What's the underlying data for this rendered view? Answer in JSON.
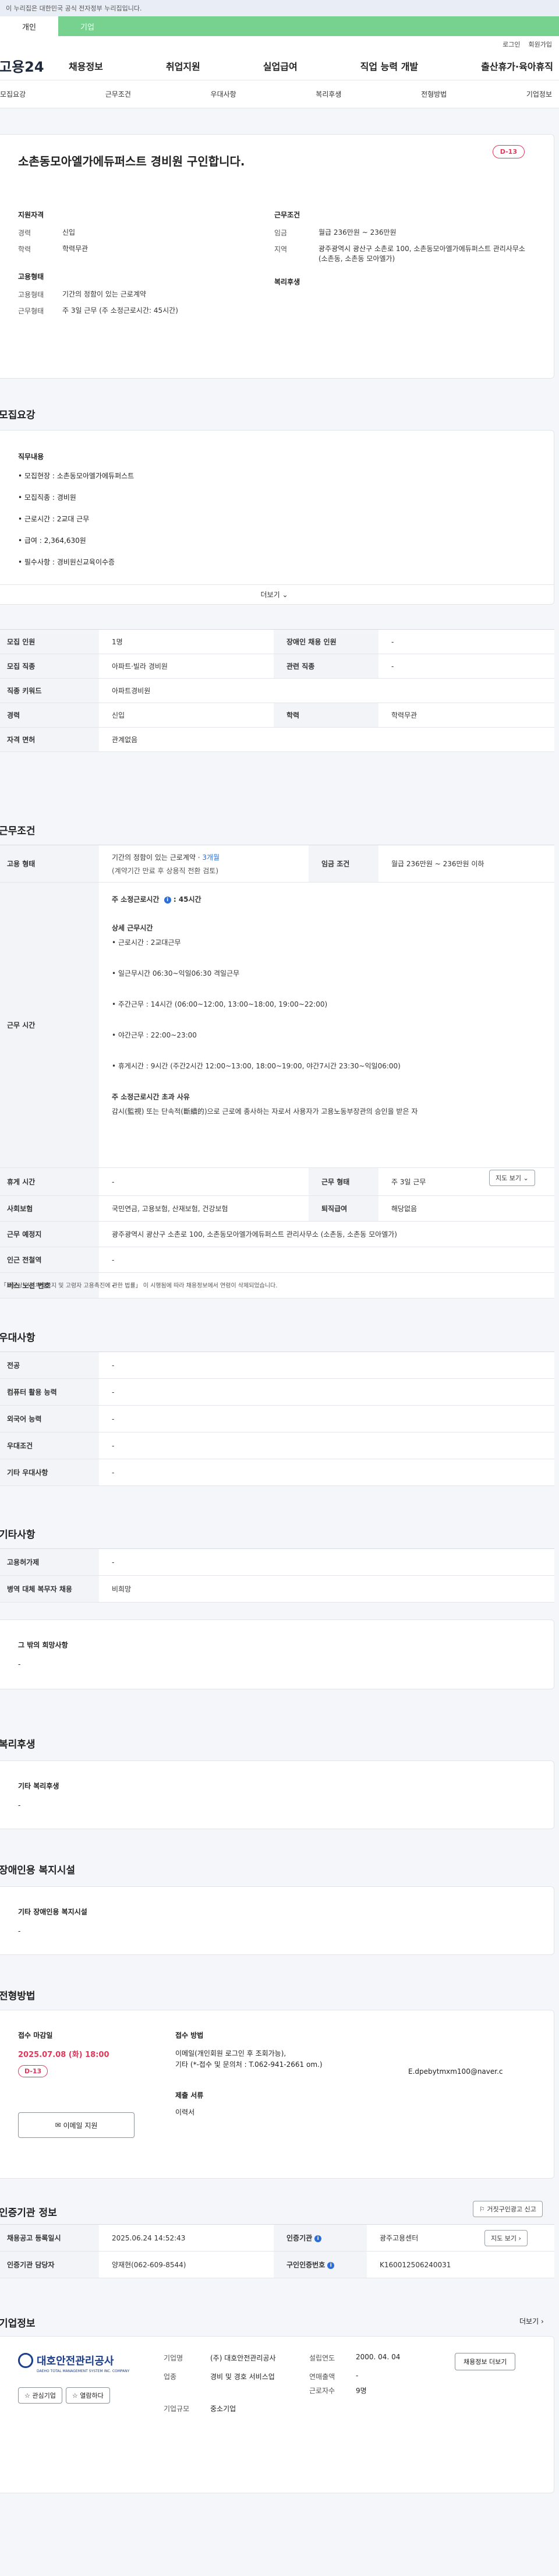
{
  "top_notice": "이 누리집은 대한민국 공식 전자정부 누리집입니다.",
  "green_tabs": [
    "개인",
    "기업"
  ],
  "util_links": [
    "로그인",
    "회원가입"
  ],
  "logo": "고용24",
  "gnb": [
    "채용정보",
    "취업지원",
    "실업급여",
    "직업 능력 개발",
    "출산휴가·육아휴직"
  ],
  "subnav": [
    "모집요강",
    "근무조건",
    "우대사항",
    "복리후생",
    "전형방법",
    "기업정보"
  ],
  "job": {
    "title": "소촌동모아엘가에듀퍼스트 경비원 구인합니다.",
    "dday": "D-13",
    "qual_title": "지원자격",
    "career_label": "경력",
    "career": "신입",
    "edu_label": "학력",
    "edu": "학력무관",
    "emp_title": "고용형태",
    "emp_label": "고용형태",
    "emp": "기간의 정함이 있는 근로계약",
    "worktype_label": "근무형태",
    "worktype": "주 3일 근무 (주 소정근로시간: 45시간)",
    "cond_title": "근무조건",
    "wage_label": "임금",
    "wage": "월급 236만원 ~ 236만원",
    "area_label": "지역",
    "area": "광주광역시 광산구 소촌로 100, 소촌동모아엘가에듀퍼스트 관리사무소 (소촌동, 소촌동 모아엘가)",
    "welfare_title": "복리후생"
  },
  "recruit": {
    "title": "모집요강",
    "duty_title": "직무내용",
    "duties": [
      "• 모집현장 : 소촌동모아엘가에듀퍼스트",
      "• 모집직종 : 경비원",
      "• 근로시간 : 2교대 근무",
      "• 급여 : 2,364,630원",
      "• 필수사항 : 경비원신교육이수증"
    ],
    "more": "더보기",
    "rows": [
      [
        "모집 인원",
        "1명",
        "장애인 채용 인원",
        "-"
      ],
      [
        "모집 직종",
        "아파트·빌라 경비원",
        "관련 직종",
        "-"
      ],
      [
        "직종 키워드",
        "아파트경비원",
        "",
        ""
      ],
      [
        "경력",
        "신입",
        "학력",
        "학력무관"
      ],
      [
        "자격 면허",
        "관계없음",
        "",
        ""
      ]
    ]
  },
  "work": {
    "title": "근무조건",
    "emp_label": "고용 형태",
    "emp_value": "기간의 정함이 있는 근로계약 · ",
    "emp_period": "3개월",
    "emp_sub": "(계약기간 만료 후 상용직 전환 검토)",
    "wage_label": "임금 조건",
    "wage_value": "월급 236만원 ~ 236만원 이하",
    "time_label": "근무 시간",
    "weekly": "주 소정근로시간",
    "weekly_value": ": 45시간",
    "detail_title": "상세 근무시간",
    "details": [
      "• 근로시간 : 2교대근무",
      "• 일근무시간 06:30~익일06:30 격일근무",
      "• 주간근무 : 14시간 (06:00~12:00, 13:00~18:00, 19:00~22:00)",
      "• 야간근무 : 22:00~23:00",
      "• 휴게시간 : 9시간 (주간2시간 12:00~13:00, 18:00~19:00, 야간7시간 23:30~익일06:00)"
    ],
    "over_title": "주 소정근로시간 초과 사유",
    "over_text": "감시(監視) 또는 단속적(斷續的)으로 근로에 종사하는 자로서 사용자가 고용노동부장관의 승인을 받은 자",
    "rest_label": "휴게 시간",
    "rest_value": "-",
    "form_label": "근무 형태",
    "form_value": "주 3일 근무",
    "ins_label": "사회보험",
    "ins_value": "국민연금, 고용보험, 산재보험, 건강보험",
    "retire_label": "퇴직급여",
    "retire_value": "해당없음",
    "place_label": "근무 예정지",
    "place_value": "광주광역시 광산구 소촌로 100, 소촌동모아엘가에듀퍼스트 관리사무소 (소촌동, 소촌동 모아엘가)",
    "map_btn": "지도 보기",
    "subway_label": "인근 전철역",
    "subway_value": "-",
    "bus_label": "버스 노선 번호",
    "bus_value": "-",
    "note": "• 「고용상 연령차별금지 및 고령자 고용촉진에 관한 법률」 이 시행됨에 따라 채용정보에서 연령이 삭제되었습니다."
  },
  "pref": {
    "title": "우대사항",
    "rows": [
      [
        "전공",
        "-"
      ],
      [
        "컴퓨터 활용 능력",
        "-"
      ],
      [
        "외국어 능력",
        "-"
      ],
      [
        "우대조건",
        "-"
      ],
      [
        "기타 우대사항",
        "-"
      ]
    ]
  },
  "etc": {
    "title": "기타사항",
    "rows": [
      [
        "고용허가제",
        "-"
      ],
      [
        "병역 대체 복무자 채용",
        "비희망"
      ]
    ],
    "hope_title": "그 밖의 희망사항",
    "hope_value": "-"
  },
  "welfare": {
    "title": "복리후생",
    "sub": "기타 복리후생",
    "value": "-"
  },
  "disabled": {
    "title": "장애인용 복지시설",
    "sub": "기타 장애인용 복지시설",
    "value": "-"
  },
  "apply": {
    "title": "전형방법",
    "deadline_label": "접수 마감일",
    "deadline": "2025.07.08 (화) 18:00",
    "dday": "D-13",
    "method_label": "접수 방법",
    "method1": "이메일(개인회원 로그인 후 조회가능),",
    "method2": "기타 (*-접수 및 문의처 : T.062-941-2661 om.)",
    "email": "E.dpebytmxm100@naver.c",
    "doc_label": "제출 서류",
    "doc_value": "이력서",
    "btn": "이메일 지원"
  },
  "cert": {
    "title": "인증기관 정보",
    "report_btn": "거짓구인광고 신고",
    "reg_label": "채용공고 등록일시",
    "reg_value": "2025.06.24 14:52:43",
    "org_label": "인증기관",
    "org_value": "광주고용센터",
    "org_btn": "지도 보기",
    "mgr_label": "인증기관 담당자",
    "mgr_value": "양재현(062-609-8544)",
    "num_label": "구인인증번호",
    "num_value": "K160012506240031"
  },
  "company": {
    "title": "기업정보",
    "more": "더보기",
    "logo": "대호안전관리공사",
    "logo_sub": "DAEHO TOTAL MANAGEMENT SYSTEM INC.  COMPANY",
    "fav_btn": "관심기업",
    "follow_btn": "열람하다",
    "name_label": "기업명",
    "name_value": "(주) 대호안전관리공사",
    "found_label": "설립연도",
    "found_value": "2000. 04. 04",
    "biz_label": "업종",
    "biz_value": "경비 및 경호 서비스업",
    "sales_label": "연매출액",
    "sales_value": "-",
    "staff_label": "근로자수",
    "staff_value": "9명",
    "size_label": "기업규모",
    "size_value": "중소기업",
    "info_btn": "채용정보 더보기"
  }
}
